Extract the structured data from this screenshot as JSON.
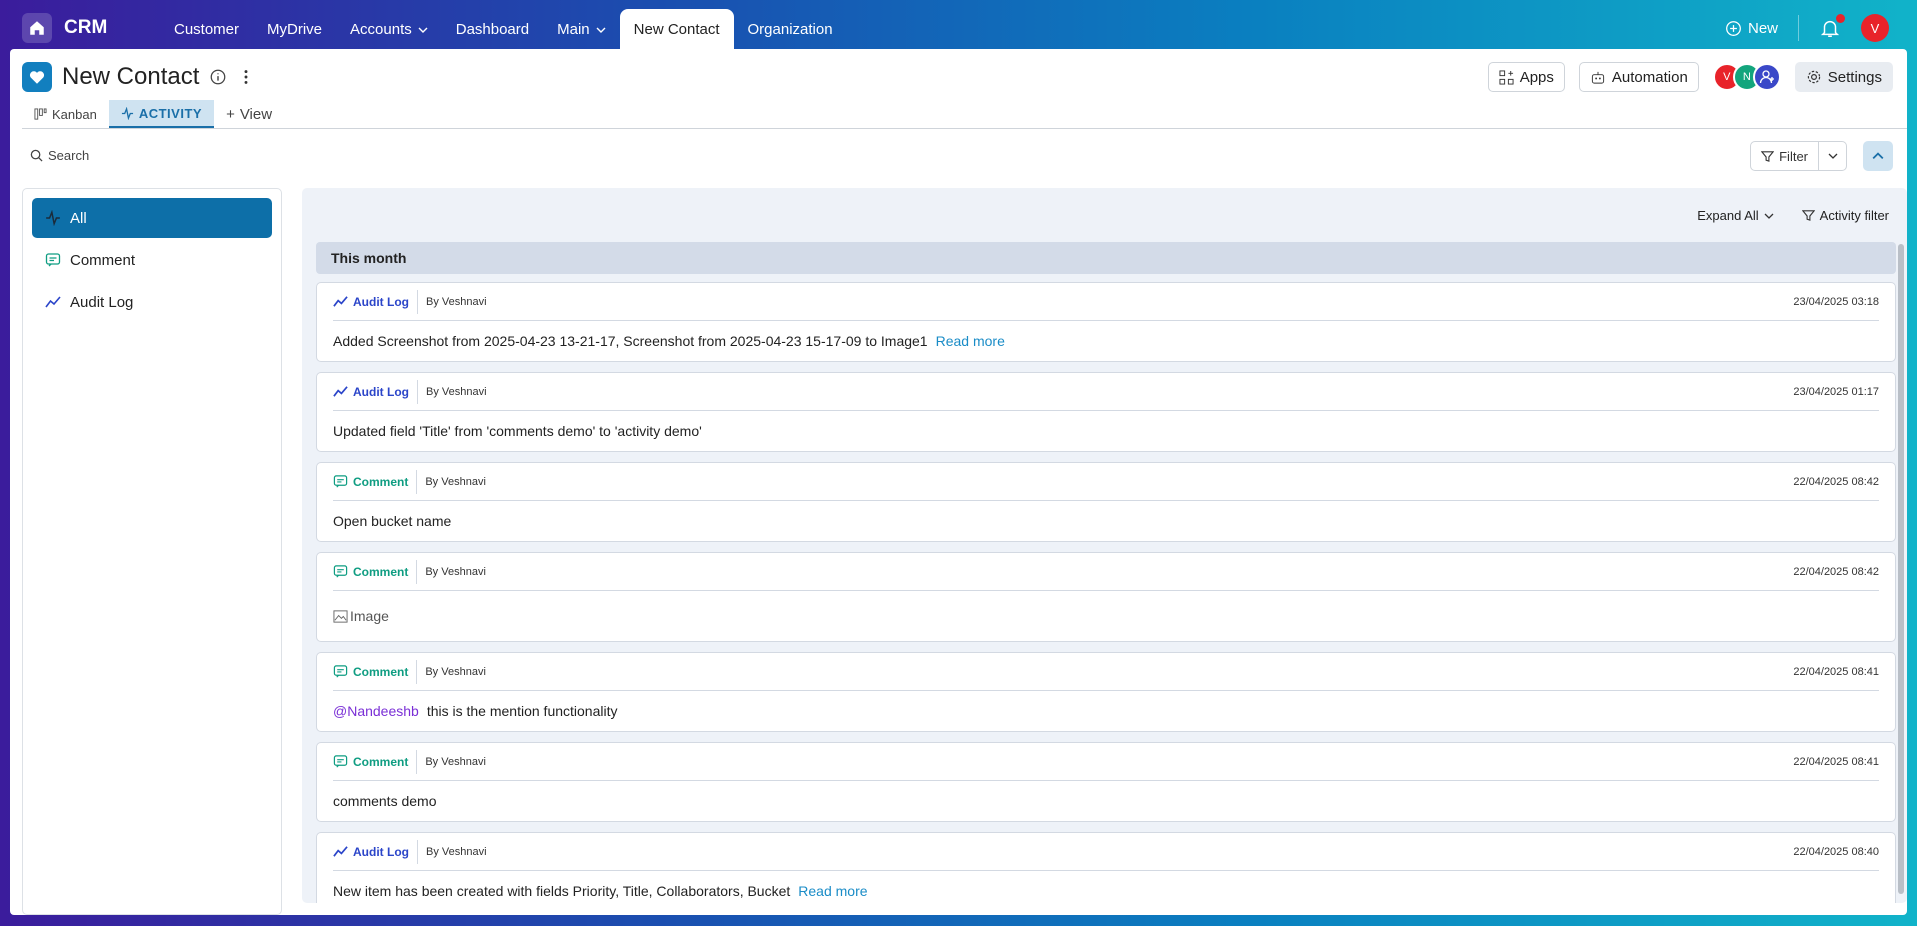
{
  "app": {
    "brand": "CRM"
  },
  "nav": {
    "items": [
      {
        "label": "Customer",
        "dropdown": false,
        "active": false
      },
      {
        "label": "MyDrive",
        "dropdown": false,
        "active": false
      },
      {
        "label": "Accounts",
        "dropdown": true,
        "active": false
      },
      {
        "label": "Dashboard",
        "dropdown": false,
        "active": false
      },
      {
        "label": "Main",
        "dropdown": true,
        "active": false
      },
      {
        "label": "New Contact",
        "dropdown": false,
        "active": true
      },
      {
        "label": "Organization",
        "dropdown": false,
        "active": false
      }
    ],
    "new_label": "New",
    "user_initial": "V"
  },
  "header": {
    "title": "New Contact",
    "apps_label": "Apps",
    "automation_label": "Automation",
    "settings_label": "Settings",
    "collaborators": [
      {
        "initial": "V",
        "color": "#e8232a"
      },
      {
        "initial": "N",
        "color": "#13a57d"
      }
    ]
  },
  "tabs": {
    "items": [
      {
        "label": "Kanban",
        "active": false
      },
      {
        "label": "ACTIVITY",
        "active": true
      }
    ],
    "add_view_label": "View"
  },
  "toolbar": {
    "search_label": "Search",
    "filter_label": "Filter"
  },
  "left_panel": {
    "items": [
      {
        "label": "All",
        "icon": "activity-icon",
        "active": true
      },
      {
        "label": "Comment",
        "icon": "comment-icon",
        "active": false
      },
      {
        "label": "Audit Log",
        "icon": "trend-icon",
        "active": false
      }
    ]
  },
  "activity": {
    "expand_all_label": "Expand All",
    "activity_filter_label": "Activity filter",
    "group_label": "This month",
    "entries": [
      {
        "type": "Audit Log",
        "kind": "audit",
        "by": "By Veshnavi",
        "time": "23/04/2025 03:18",
        "text": "Added Screenshot from 2025-04-23 13-21-17, Screenshot from 2025-04-23 15-17-09 to Image1",
        "read_more": "Read more"
      },
      {
        "type": "Audit Log",
        "kind": "audit",
        "by": "By Veshnavi",
        "time": "23/04/2025 01:17",
        "text": "Updated field 'Title' from 'comments demo' to 'activity demo'"
      },
      {
        "type": "Comment",
        "kind": "comment",
        "by": "By Veshnavi",
        "time": "22/04/2025 08:42",
        "text": "Open bucket name"
      },
      {
        "type": "Comment",
        "kind": "comment",
        "by": "By Veshnavi",
        "time": "22/04/2025 08:42",
        "image_label": "Image"
      },
      {
        "type": "Comment",
        "kind": "comment",
        "by": "By Veshnavi",
        "time": "22/04/2025 08:41",
        "mention": "@Nandeeshb",
        "text": "this is the mention functionality"
      },
      {
        "type": "Comment",
        "kind": "comment",
        "by": "By Veshnavi",
        "time": "22/04/2025 08:41",
        "text": "comments demo"
      },
      {
        "type": "Audit Log",
        "kind": "audit",
        "by": "By Veshnavi",
        "time": "22/04/2025 08:40",
        "text": "New item has been created with fields Priority, Title, Collaborators, Bucket",
        "read_more": "Read more"
      }
    ]
  }
}
